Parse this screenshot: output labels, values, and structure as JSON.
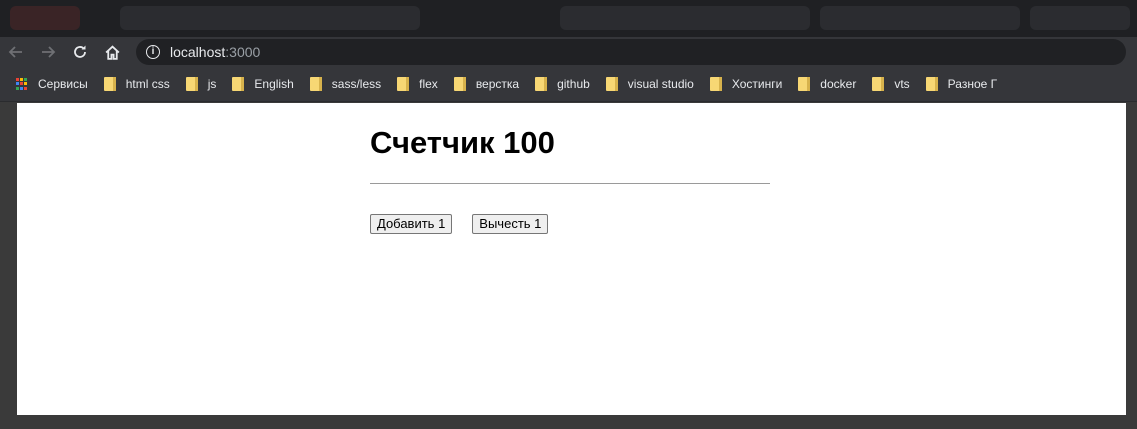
{
  "browser": {
    "address": {
      "host": "localhost",
      "port": ":3000"
    },
    "nav": {
      "back_icon": "arrow-left-icon",
      "forward_icon": "arrow-right-icon",
      "reload_icon": "reload-icon",
      "home_icon": "home-icon"
    },
    "bookmarks": [
      {
        "label": "Сервисы",
        "icon": "apps-grid-icon"
      },
      {
        "label": "html css",
        "icon": "folder-icon"
      },
      {
        "label": "js",
        "icon": "folder-icon"
      },
      {
        "label": "English",
        "icon": "folder-icon"
      },
      {
        "label": "sass/less",
        "icon": "folder-icon"
      },
      {
        "label": "flex",
        "icon": "folder-icon"
      },
      {
        "label": "верстка",
        "icon": "folder-icon"
      },
      {
        "label": "github",
        "icon": "folder-icon"
      },
      {
        "label": "visual studio",
        "icon": "folder-icon"
      },
      {
        "label": "Хостинги",
        "icon": "folder-icon"
      },
      {
        "label": "docker",
        "icon": "folder-icon"
      },
      {
        "label": "vts",
        "icon": "folder-icon"
      },
      {
        "label": "Разное Г",
        "icon": "folder-icon"
      }
    ]
  },
  "page": {
    "title": "Счетчик 100",
    "buttons": {
      "add": "Добавить 1",
      "subtract": "Вычесть 1"
    }
  },
  "colors": {
    "toolbar": "#35363a",
    "omnibox": "#202124",
    "folder": "#f7d774"
  }
}
